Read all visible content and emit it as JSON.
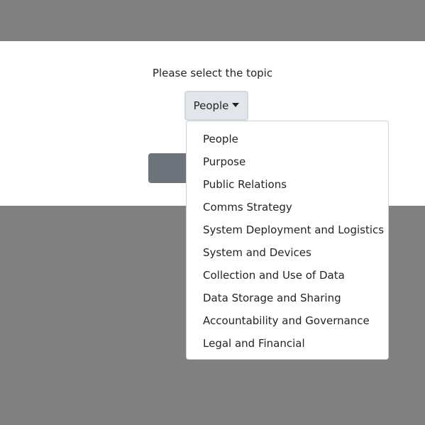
{
  "prompt": "Please select the topic",
  "dropdown": {
    "selected": "People",
    "options": [
      "People",
      "Purpose",
      "Public Relations",
      "Comms Strategy",
      "System Deployment and Logistics",
      "System and Devices",
      "Collection and Use of Data",
      "Data Storage and Sharing",
      "Accountability and Governance",
      "Legal and Financial"
    ]
  },
  "colors": {
    "backdrop": "#808080",
    "panel": "#ffffff",
    "toggle_bg": "#e2e6ea",
    "toggle_border": "#cfd8e3",
    "submit_bg": "#6c757d",
    "text": "#212529"
  },
  "icons": {
    "toggle": "caret-down-icon"
  }
}
